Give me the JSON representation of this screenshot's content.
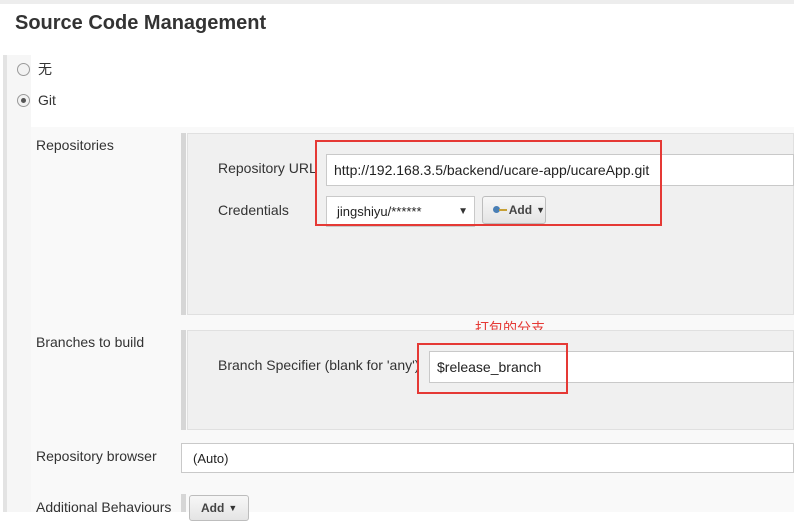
{
  "section": {
    "title": "Source Code Management"
  },
  "scm_options": [
    {
      "label": "无",
      "selected": false
    },
    {
      "label": "Git",
      "selected": true
    }
  ],
  "repositories": {
    "label": "Repositories",
    "url_label": "Repository URL",
    "url_value": "http://192.168.3.5/backend/ucare-app/ucareApp.git",
    "credentials_label": "Credentials",
    "credentials_value": "jingshiyu/******",
    "add_button_label": "Add"
  },
  "branches": {
    "label": "Branches to build",
    "specifier_label": "Branch Specifier (blank for 'any')",
    "specifier_value": "$release_branch",
    "annotation": "打包的分支"
  },
  "repository_browser": {
    "label": "Repository browser",
    "value": "(Auto)"
  },
  "additional_behaviours": {
    "label": "Additional Behaviours",
    "add_button_label": "Add"
  },
  "colors": {
    "annotation_red": "#e53935",
    "panel_gray": "#f0f0f0"
  }
}
